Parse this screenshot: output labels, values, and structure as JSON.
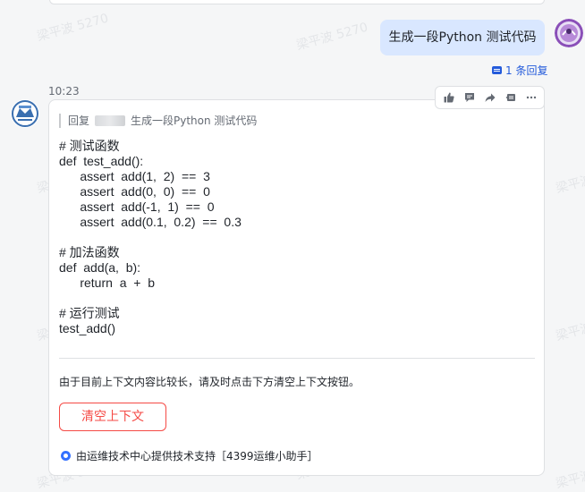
{
  "watermark_text": "梁平波 5270",
  "user_message": {
    "text": "生成一段Python 测试代码"
  },
  "reply_count": {
    "label": "1 条回复"
  },
  "bot_message": {
    "time": "10:23",
    "reply_quote": {
      "prefix": "回复",
      "quoted_text": "生成一段Python 测试代码"
    },
    "code_lines": [
      "# 测试函数",
      "def  test_add():",
      "      assert  add(1,  2)  ==  3",
      "      assert  add(0,  0)  ==  0",
      "      assert  add(-1,  1)  ==  0",
      "      assert  add(0.1,  0.2)  ==  0.3",
      "",
      "# 加法函数",
      "def  add(a,  b):",
      "      return  a  +  b",
      "",
      "# 运行测试",
      "test_add()"
    ],
    "note": "由于目前上下文内容比较长，请及时点击下方清空上下文按钮。",
    "clear_button_label": "清空上下文",
    "support_text": "由运维技术中心提供技术支持［4399运维小助手］"
  },
  "toolbar_icons": [
    "thumbs-up-icon",
    "comment-icon",
    "forward-icon",
    "reply-icon",
    "more-icon"
  ]
}
